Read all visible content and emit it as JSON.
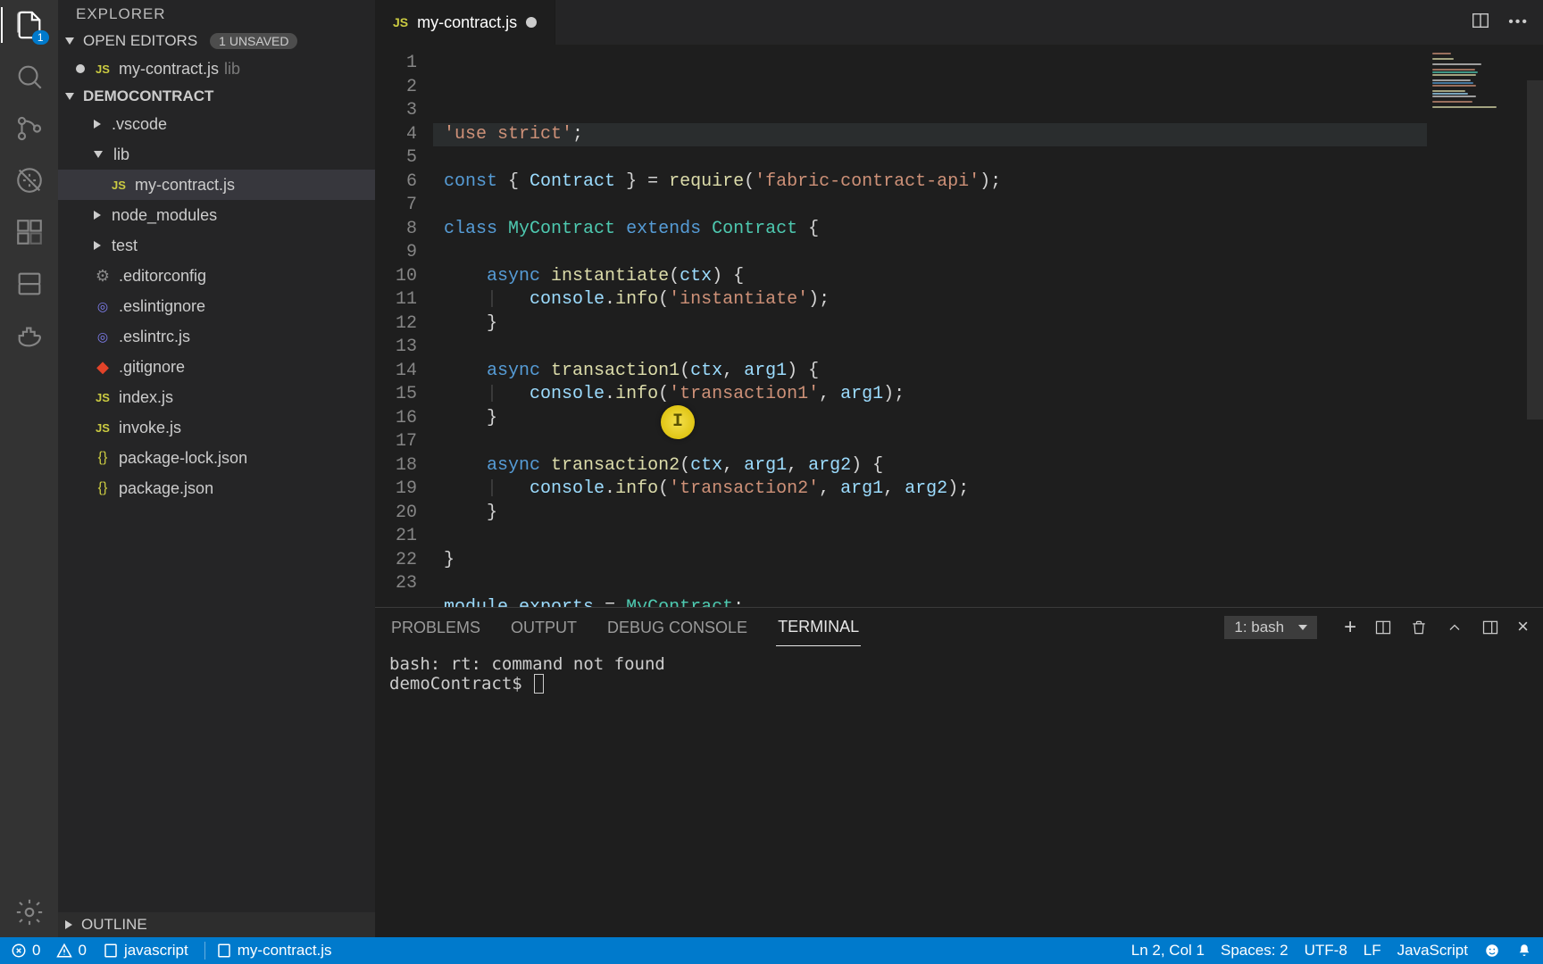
{
  "activity_badge": "1",
  "sidebar": {
    "title": "EXPLORER",
    "open_editors_label": "OPEN EDITORS",
    "unsaved_label": "1 UNSAVED",
    "open_editor_item": {
      "name": "my-contract.js",
      "dir": "lib"
    },
    "project_name": "DEMOCONTRACT",
    "tree": {
      "vscode": ".vscode",
      "lib": "lib",
      "lib_file": "my-contract.js",
      "node_modules": "node_modules",
      "test": "test",
      "editorconfig": ".editorconfig",
      "eslintignore": ".eslintignore",
      "eslintrc": ".eslintrc.js",
      "gitignore": ".gitignore",
      "index": "index.js",
      "invoke": "invoke.js",
      "pkg_lock": "package-lock.json",
      "pkg": "package.json"
    },
    "outline_label": "OUTLINE"
  },
  "tab": {
    "name": "my-contract.js"
  },
  "code_lines": [
    {
      "n": 1,
      "html": ""
    },
    {
      "n": 2,
      "html": "<span class='st'>'use strict'</span><span class='pn'>;</span>",
      "hl": true
    },
    {
      "n": 3,
      "html": ""
    },
    {
      "n": 4,
      "html": "<span class='kw'>const</span> <span class='pn'>{ </span><span class='vr'>Contract</span><span class='pn'> } = </span><span class='fn'>require</span><span class='pn'>(</span><span class='st'>'fabric-contract-api'</span><span class='pn'>);</span>"
    },
    {
      "n": 5,
      "html": ""
    },
    {
      "n": 6,
      "html": "<span class='kw'>class</span> <span class='ty'>MyContract</span> <span class='kw'>extends</span> <span class='ty'>Contract</span> <span class='pn'>{</span>"
    },
    {
      "n": 7,
      "html": ""
    },
    {
      "n": 8,
      "html": "    <span class='kw'>async</span> <span class='fn'>instantiate</span><span class='pn'>(</span><span class='vr'>ctx</span><span class='pn'>) {</span>"
    },
    {
      "n": 9,
      "html": "    <span class='ghost-bar'>|   </span><span class='vr'>console</span><span class='pn'>.</span><span class='fn'>info</span><span class='pn'>(</span><span class='st'>'instantiate'</span><span class='pn'>);</span>"
    },
    {
      "n": 10,
      "html": "    <span class='pn'>}</span>"
    },
    {
      "n": 11,
      "html": ""
    },
    {
      "n": 12,
      "html": "    <span class='kw'>async</span> <span class='fn'>transaction1</span><span class='pn'>(</span><span class='vr'>ctx</span><span class='pn'>, </span><span class='vr'>arg1</span><span class='pn'>) {</span>"
    },
    {
      "n": 13,
      "html": "    <span class='ghost-bar'>|   </span><span class='vr'>console</span><span class='pn'>.</span><span class='fn'>info</span><span class='pn'>(</span><span class='st'>'transaction1'</span><span class='pn'>, </span><span class='vr'>arg1</span><span class='pn'>);</span>"
    },
    {
      "n": 14,
      "html": "    <span class='pn'>}</span>"
    },
    {
      "n": 15,
      "html": ""
    },
    {
      "n": 16,
      "html": "    <span class='kw'>async</span> <span class='fn'>transaction2</span><span class='pn'>(</span><span class='vr'>ctx</span><span class='pn'>, </span><span class='vr'>arg1</span><span class='pn'>, </span><span class='vr'>arg2</span><span class='pn'>) {</span>"
    },
    {
      "n": 17,
      "html": "    <span class='ghost-bar'>|   </span><span class='vr'>console</span><span class='pn'>.</span><span class='fn'>info</span><span class='pn'>(</span><span class='st'>'transaction2'</span><span class='pn'>, </span><span class='vr'>arg1</span><span class='pn'>, </span><span class='vr'>arg2</span><span class='pn'>);</span>"
    },
    {
      "n": 18,
      "html": "    <span class='pn'>}</span>"
    },
    {
      "n": 19,
      "html": ""
    },
    {
      "n": 20,
      "html": "<span class='pn'>}</span>"
    },
    {
      "n": 21,
      "html": ""
    },
    {
      "n": 22,
      "html": "<span class='vr'>module</span><span class='pn'>.</span><span class='vr'>exports</span> <span class='pn'>= </span><span class='ty'>MyContract</span><span class='pn'>;</span>"
    },
    {
      "n": 23,
      "html": ""
    }
  ],
  "panel": {
    "tabs": {
      "problems": "PROBLEMS",
      "output": "OUTPUT",
      "debug": "DEBUG CONSOLE",
      "terminal": "TERMINAL"
    },
    "dropdown": "1: bash",
    "terminal_lines": [
      "bash: rt: command not found",
      "demoContract$ "
    ]
  },
  "status": {
    "errors": "0",
    "warnings": "0",
    "lang_client": "javascript",
    "file_path": "my-contract.js",
    "cursor": "Ln 2, Col 1",
    "spaces": "Spaces: 2",
    "encoding": "UTF-8",
    "eol": "LF",
    "language": "JavaScript"
  }
}
